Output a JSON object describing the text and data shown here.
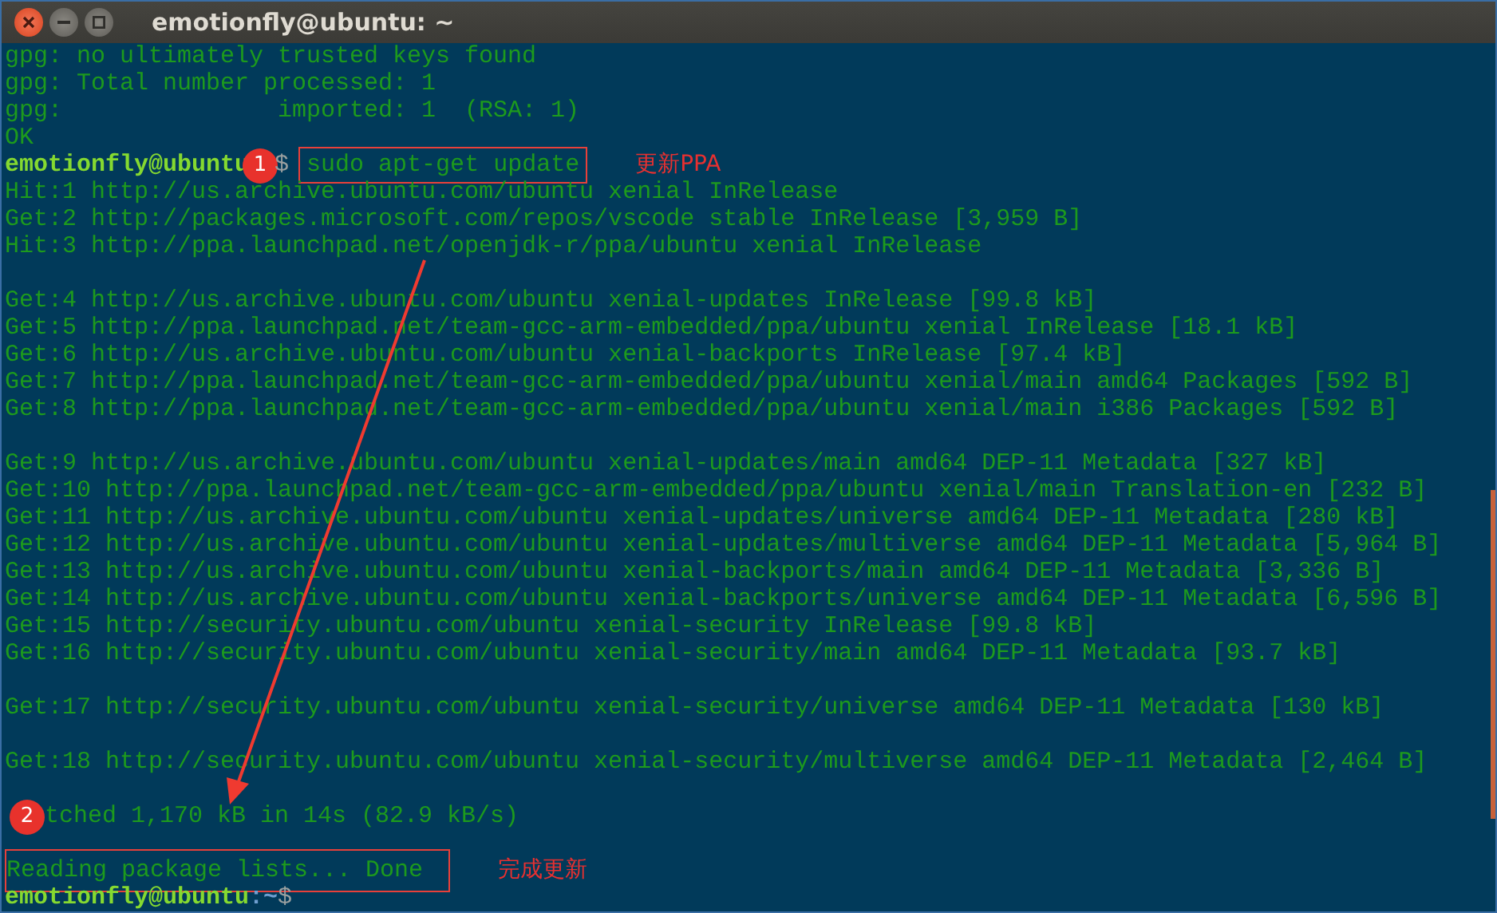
{
  "window": {
    "title": "emotionfly@ubuntu: ~"
  },
  "lines": [
    {
      "kind": "output",
      "text": "gpg: no ultimately trusted keys found"
    },
    {
      "kind": "output",
      "text": "gpg: Total number processed: 1"
    },
    {
      "kind": "output",
      "text": "gpg:               imported: 1  (RSA: 1)"
    },
    {
      "kind": "output",
      "text": "OK"
    },
    {
      "kind": "prompt",
      "user": "emotionfly@ubuntu",
      "badge": "1",
      "sign": "$",
      "command": "sudo apt-get update",
      "boxed": true,
      "note": "更新PPA"
    },
    {
      "kind": "output",
      "text": "Hit:1 http://us.archive.ubuntu.com/ubuntu xenial InRelease"
    },
    {
      "kind": "output",
      "text": "Get:2 http://packages.microsoft.com/repos/vscode stable InRelease [3,959 B]"
    },
    {
      "kind": "output",
      "text": "Hit:3 http://ppa.launchpad.net/openjdk-r/ppa/ubuntu xenial InRelease"
    },
    {
      "kind": "blank"
    },
    {
      "kind": "output",
      "text": "Get:4 http://us.archive.ubuntu.com/ubuntu xenial-updates InRelease [99.8 kB]"
    },
    {
      "kind": "output",
      "text": "Get:5 http://ppa.launchpad.net/team-gcc-arm-embedded/ppa/ubuntu xenial InRelease [18.1 kB]"
    },
    {
      "kind": "output",
      "text": "Get:6 http://us.archive.ubuntu.com/ubuntu xenial-backports InRelease [97.4 kB]"
    },
    {
      "kind": "output",
      "text": "Get:7 http://ppa.launchpad.net/team-gcc-arm-embedded/ppa/ubuntu xenial/main amd64 Packages [592 B]"
    },
    {
      "kind": "output",
      "text": "Get:8 http://ppa.launchpad.net/team-gcc-arm-embedded/ppa/ubuntu xenial/main i386 Packages [592 B]"
    },
    {
      "kind": "blank"
    },
    {
      "kind": "output",
      "text": "Get:9 http://us.archive.ubuntu.com/ubuntu xenial-updates/main amd64 DEP-11 Metadata [327 kB]"
    },
    {
      "kind": "output",
      "text": "Get:10 http://ppa.launchpad.net/team-gcc-arm-embedded/ppa/ubuntu xenial/main Translation-en [232 B]"
    },
    {
      "kind": "output",
      "text": "Get:11 http://us.archive.ubuntu.com/ubuntu xenial-updates/universe amd64 DEP-11 Metadata [280 kB]"
    },
    {
      "kind": "output",
      "text": "Get:12 http://us.archive.ubuntu.com/ubuntu xenial-updates/multiverse amd64 DEP-11 Metadata [5,964 B]"
    },
    {
      "kind": "output",
      "text": "Get:13 http://us.archive.ubuntu.com/ubuntu xenial-backports/main amd64 DEP-11 Metadata [3,336 B]"
    },
    {
      "kind": "output",
      "text": "Get:14 http://us.archive.ubuntu.com/ubuntu xenial-backports/universe amd64 DEP-11 Metadata [6,596 B]"
    },
    {
      "kind": "output",
      "text": "Get:15 http://security.ubuntu.com/ubuntu xenial-security InRelease [99.8 kB]"
    },
    {
      "kind": "output",
      "text": "Get:16 http://security.ubuntu.com/ubuntu xenial-security/main amd64 DEP-11 Metadata [93.7 kB]"
    },
    {
      "kind": "blank"
    },
    {
      "kind": "output",
      "text": "Get:17 http://security.ubuntu.com/ubuntu xenial-security/universe amd64 DEP-11 Metadata [130 kB]"
    },
    {
      "kind": "blank"
    },
    {
      "kind": "output",
      "text": "Get:18 http://security.ubuntu.com/ubuntu xenial-security/multiverse amd64 DEP-11 Metadata [2,464 B]"
    },
    {
      "kind": "blank"
    },
    {
      "kind": "output",
      "badge": "2",
      "text": "tched 1,170 kB in 14s (82.9 kB/s)"
    },
    {
      "kind": "blank"
    },
    {
      "kind": "output",
      "text": "Reading package lists... Done",
      "boxed": true,
      "note": "完成更新"
    },
    {
      "kind": "prompt",
      "user": "emotionfly@ubuntu",
      "path": ":~",
      "sign": "$"
    }
  ]
}
